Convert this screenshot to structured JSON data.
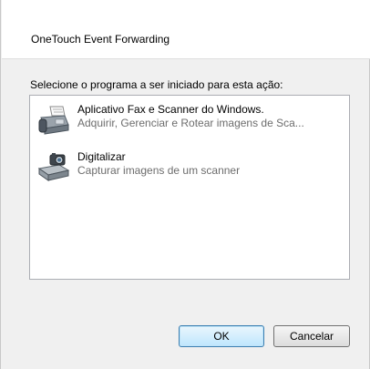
{
  "dialog": {
    "title": "OneTouch Event Forwarding",
    "prompt": "Selecione o programa a ser iniciado para esta ação:",
    "programs": [
      {
        "name": "Aplicativo Fax e Scanner do Windows.",
        "description": "Adquirir, Gerenciar e Rotear imagens de Sca...",
        "icon": "fax-scanner-icon"
      },
      {
        "name": "Digitalizar",
        "description": "Capturar imagens de um scanner",
        "icon": "scanner-camera-icon"
      }
    ],
    "ok_label": "OK",
    "cancel_label": "Cancelar"
  }
}
